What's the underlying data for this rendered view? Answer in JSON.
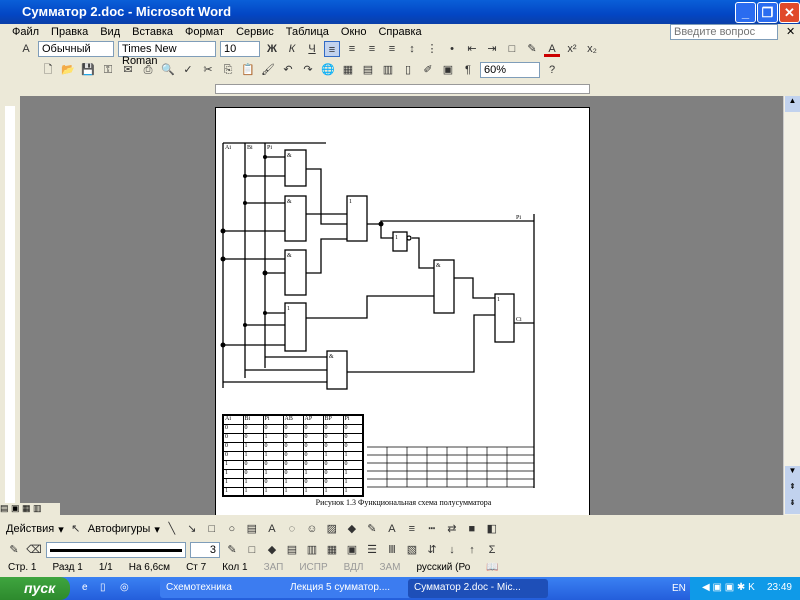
{
  "window": {
    "title": "Сумматор 2.doc - Microsoft Word"
  },
  "menu": [
    "Файл",
    "Правка",
    "Вид",
    "Вставка",
    "Формат",
    "Сервис",
    "Таблица",
    "Окно",
    "Справка"
  ],
  "help_placeholder": "Введите вопрос",
  "formatting": {
    "style": "Обычный",
    "font": "Times New Roman",
    "size": "10",
    "bold": "Ж",
    "italic": "К",
    "underline": "Ч"
  },
  "standard": {
    "zoom": "60%"
  },
  "diagram": {
    "inputs": [
      "Ai",
      "Bi",
      "Pi"
    ],
    "gates": [
      "&",
      "&",
      "&",
      "1",
      "&",
      "1",
      "1",
      "&",
      "1"
    ],
    "outputs": [
      "Pi",
      "Ci"
    ]
  },
  "truth_table": {
    "headers": [
      "Ai",
      "Bi",
      "Pi",
      "AB",
      "AP",
      "BP",
      "Pi"
    ],
    "rows": [
      [
        "0",
        "0",
        "0",
        "0",
        "0",
        "0",
        "0"
      ],
      [
        "0",
        "0",
        "1",
        "0",
        "0",
        "0",
        "0"
      ],
      [
        "0",
        "1",
        "0",
        "0",
        "0",
        "0",
        "0"
      ],
      [
        "0",
        "1",
        "1",
        "0",
        "0",
        "1",
        "1"
      ],
      [
        "1",
        "0",
        "0",
        "0",
        "0",
        "0",
        "0"
      ],
      [
        "1",
        "0",
        "1",
        "0",
        "1",
        "0",
        "1"
      ],
      [
        "1",
        "1",
        "0",
        "1",
        "0",
        "0",
        "1"
      ],
      [
        "1",
        "1",
        "1",
        "1",
        "1",
        "1",
        "1"
      ]
    ]
  },
  "caption": "Рисунок 1.3  Функциональная схема полусумматора",
  "drawing": {
    "actions": "Действия",
    "autoshapes": "Автофигуры",
    "line_width": "3"
  },
  "status": {
    "page": "Стр. 1",
    "section": "Разд 1",
    "pages": "1/1",
    "at": "На 6,6см",
    "line": "Ст 7",
    "col": "Кол 1",
    "rec": "ЗАП",
    "trk": "ИСПР",
    "ext": "ВДЛ",
    "ovr": "ЗАМ",
    "lang": "русский (Ро"
  },
  "taskbar": {
    "start": "пуск",
    "tasks": [
      "Схемотехника",
      "Лекция 5 сумматор....",
      "Сумматор 2.doc - Mic..."
    ],
    "lang": "EN",
    "clock": "23:49"
  }
}
